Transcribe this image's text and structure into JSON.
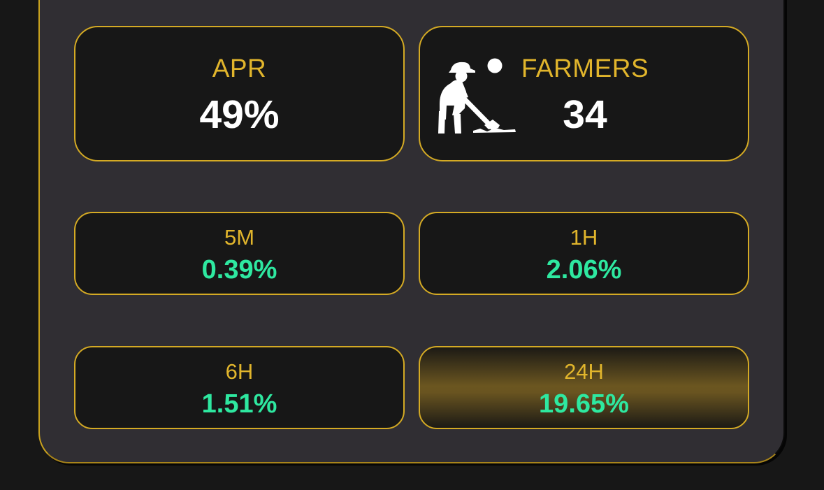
{
  "stats": {
    "apr": {
      "label": "APR",
      "value": "49%"
    },
    "farmers": {
      "label": "FARMERS",
      "value": "34",
      "icon": "farmer-icon"
    }
  },
  "changes": [
    {
      "label": "5M",
      "value": "0.39%"
    },
    {
      "label": "1H",
      "value": "2.06%"
    },
    {
      "label": "6H",
      "value": "1.51%"
    },
    {
      "label": "24H",
      "value": "19.65%",
      "highlighted": true
    }
  ],
  "colors": {
    "background": "#171717",
    "panel": "#302e33",
    "accent_gold": "#d4aa24",
    "label_gold": "#e1b52c",
    "positive_green": "#2ee8a0",
    "value_white": "#ffffff"
  }
}
